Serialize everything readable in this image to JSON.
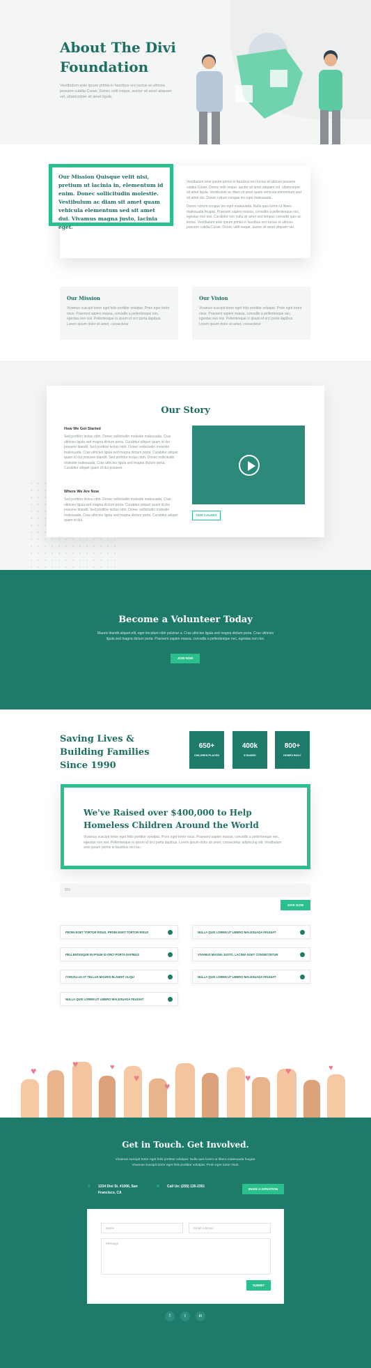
{
  "hero": {
    "title": "About The Divi Foundation",
    "text": "Vestibulum ante ipsum primis in faucibus orci luctus et ultrices posuere cubilia Curae; Donec velit neque, auctor sit amet aliquam vel, ullamcorper sit amet ligula."
  },
  "mission": {
    "quote": "Our Mission Quisque velit nisi, pretium ut lacinia in, elementum id enim. Donec sollicitudin molestie. Vestibulum ac diam sit amet quam vehicula elementum sed sit amet dui. Vivamus magna justo, lacinia eget.",
    "para1": "Vestibulum ante ipsum primis in faucibus orci luctus et ultrices posuere cubilia Curae; Donec velit neque, auctor sit amet aliquam vel, ullamcorper sit amet ligula. Vestibulum ac diam sit amet quam vehicula elementum sed sit amet dui. Donec rutrum congue leo eget malesuada.",
    "para2": "Donec rutrum congue leo eget malesuada. Nulla quis lorem ut libero malesuada feugiat. Praesent sapien massa, convallis a pellentesque nec, egestas non nisi. Curabitur non nulla sit amet nisl tempus convallis quis ac lectus. Vestibulum ante ipsum primis in faucibus orci luctus et ultrices posuere cubilia Curae; Donec velit neque, auctor sit amet aliquam vel.",
    "cards": [
      {
        "title": "Our Mission",
        "text": "Vivamus suscipit tortor eget felis porttitor volutpat. Proin eget tortor risus. Praesent sapien massa, convallis a pellentesque nec, egestas non nisi. Pellentesque in ipsum id orci porta dapibus. Lorem ipsum dolor sit amet, consectetur"
      },
      {
        "title": "Our Vision",
        "text": "Vivamus suscipit tortor eget felis porttitor volutpat. Proin eget tortor risus. Praesent sapien massa, convallis a pellentesque nec, egestas non nisi. Pellentesque in ipsum id orci porta dapibus. Lorem ipsum dolor sit amet, consectetur"
      }
    ]
  },
  "story": {
    "title": "Our Story",
    "h1": "How We Got Started",
    "p1": "Sed porttitor lectus nibh. Donec sollicitudin molestie malesuada. Cras ultricies ligula sed magna dictum porta. Curabitur aliquet quam id dui posuere blandit. Sed porttitor lectus nibh. Donec sollicitudin molestie malesuada. Cras ultricies ligula sed magna dictum porta. Curabitur aliquet quam id dui posuere blandit. Sed porttitor lectus nibh. Donec sollicitudin molestie malesuada. Cras ultricies ligula sed magna dictum porta. Curabitur aliquet quam id dui posuere.",
    "h2": "Where We Are Now",
    "p2": "Sed porttitor lectus nibh. Donec sollicitudin molestie malesuada. Cras ultricies ligula sed magna dictum porta. Curabitur aliquet quam id dui posuere blandit. Sed porttitor lectus nibh. Donec sollicitudin molestie malesuada. Cras ultricies ligula sed magna dictum porta. Curabitur aliquet quam id dui.",
    "button": "OUR CAUSES"
  },
  "volunteer": {
    "title": "Become a Volunteer Today",
    "text": "Mauris blandit aliquet elit, eget tincidunt nibh pulvinar a. Cras ultricies ligula sed magna dictum porta. Cras ultricies ligula sed magna dictum porta. Praesent sapien massa, convallis a pellentesque nec, egestas non nisi.",
    "button": "JOIN NOW"
  },
  "stats": {
    "heading": "Saving Lives & Building Families Since 1990",
    "items": [
      {
        "value": "650+",
        "label": "CHILDREN PLACED"
      },
      {
        "value": "400k",
        "label": "$ RAISED"
      },
      {
        "value": "800+",
        "label": "HOMES BUILT"
      }
    ]
  },
  "raised": {
    "title": "We've Raised over $400,000 to Help Homeless Children Around the World",
    "text": "Vivamus suscipit tortor eget felis porttitor volutpat. Proin eget tortor risus. Praesent sapien massa, convallis a pellentesque nec, egestas non nisi. Pellentesque in ipsum id orci porta dapibus. Lorem ipsum dolor sit amet, consectetur adipiscing elit. Vestibulum ante ipsum primis in faucibus orci luc."
  },
  "donate": {
    "amount_placeholder": "$50",
    "button": "GIVE NOW"
  },
  "faq": [
    "PROIN EGET TORTOR RISUS. PROIN EGET TORTOR RISUS",
    "NULLA QUIS LOREM UT LIBERO MALESUADA FEUGIAT",
    "PELLENTESQUE IN IPSUM ID ORCI PORTA DAPIBUS",
    "VIVAMUS MAGNA JUSTO, LACINIA EGET CONSECTETUR",
    "CONVALLIS AT TELLUS MAURIS BLANDIT ALIQU",
    "NULLA QUIS LOREM UT LIBERO MALESUADA FEUGIAT",
    "NULLA QUIS LOREM UT LIBERO MALESUADA FEUGIAT"
  ],
  "contact": {
    "title": "Get in Touch. Get Involved.",
    "text": "Vivamus suscipit tortor eget felis porttitor volutpat. Nulla quis lorem ut libero malesuada feugiat. Vivamus suscipit tortor eget felis porttitor volutpat. Proin eget tortor risus.",
    "address": "1234 Divi St. #1000, San Francisco, CA",
    "phone": "Call Us: (255) 135-2351",
    "donate_button": "MAKE A DONATION",
    "name_placeholder": "Name",
    "email_placeholder": "Email Address",
    "message_placeholder": "Message",
    "submit": "SUBMIT"
  },
  "social": [
    "f",
    "t",
    "in"
  ],
  "colors": {
    "primary": "#1e7a69",
    "accent": "#2bbf8e",
    "heart": "#f07a8c"
  }
}
